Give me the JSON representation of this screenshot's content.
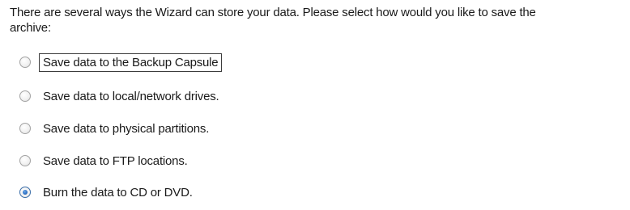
{
  "wizard": {
    "instruction": "There are several ways the Wizard can store your data. Please select how would you like to save the\narchive:",
    "options": [
      {
        "label": "Save data to the Backup Capsule",
        "selected": false,
        "focused": true
      },
      {
        "label": "Save data to local/network drives.",
        "selected": false,
        "focused": false
      },
      {
        "label": "Save data to physical partitions.",
        "selected": false,
        "focused": false
      },
      {
        "label": "Save data to FTP locations.",
        "selected": false,
        "focused": false
      },
      {
        "label": "Burn the data to CD or DVD.",
        "selected": true,
        "focused": false
      }
    ]
  },
  "colors": {
    "radio_selected": "#2a6fc4",
    "background": "#ffffff"
  }
}
